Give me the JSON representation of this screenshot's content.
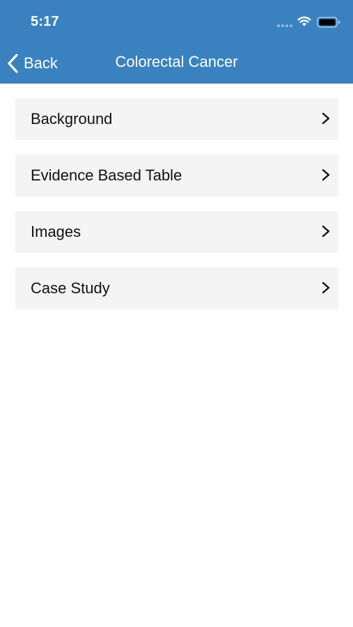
{
  "status_bar": {
    "time": "5:17"
  },
  "nav": {
    "back_label": "Back",
    "title": "Colorectal Cancer"
  },
  "menu": {
    "items": [
      {
        "label": "Background"
      },
      {
        "label": "Evidence Based Table"
      },
      {
        "label": "Images"
      },
      {
        "label": "Case Study"
      }
    ]
  },
  "colors": {
    "header_background": "#3a82bf",
    "menu_item_background": "#f4f4f4",
    "page_background": "#ffffff"
  },
  "icons": [
    "signal-icon",
    "wifi-icon",
    "battery-icon",
    "back-chevron-icon",
    "chevron-right-icon"
  ]
}
